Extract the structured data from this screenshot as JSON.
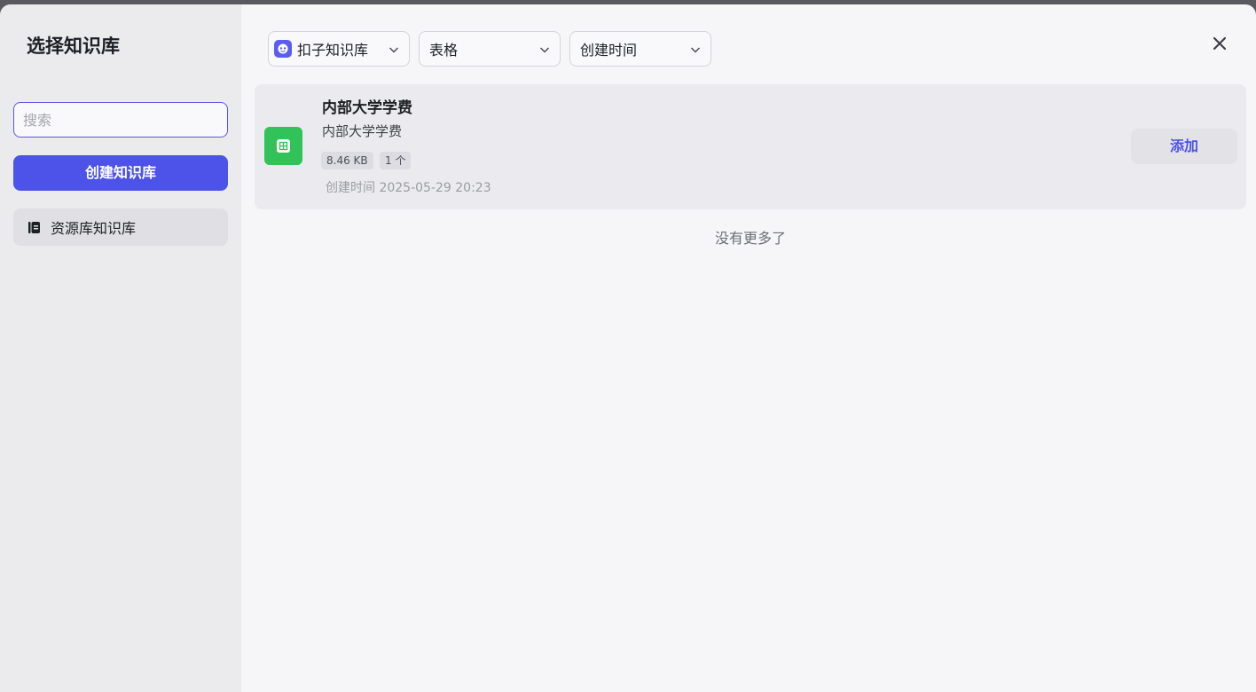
{
  "modal": {
    "title": "选择知识库"
  },
  "sidebar": {
    "search_placeholder": "搜索",
    "create_button": "创建知识库",
    "items": [
      {
        "label": "资源库知识库",
        "icon": "book-icon"
      }
    ]
  },
  "filters": {
    "source": {
      "label": "扣子知识库",
      "icon": "coze-brand-icon"
    },
    "type": {
      "label": "表格"
    },
    "sort": {
      "label": "创建时间"
    }
  },
  "knowledge_bases": [
    {
      "name": "内部大学学费",
      "description": "内部大学学费",
      "size": "8.46 KB",
      "count": "1 个",
      "created": "创建时间 2025-05-29 20:23",
      "action": "添加",
      "icon": "table-file-icon"
    }
  ],
  "list_end_text": "没有更多了",
  "colors": {
    "accent": "#4d53e8",
    "file_icon_green": "#32c25a",
    "sidebar_bg": "#ebebee",
    "main_bg": "#f6f6f8"
  }
}
